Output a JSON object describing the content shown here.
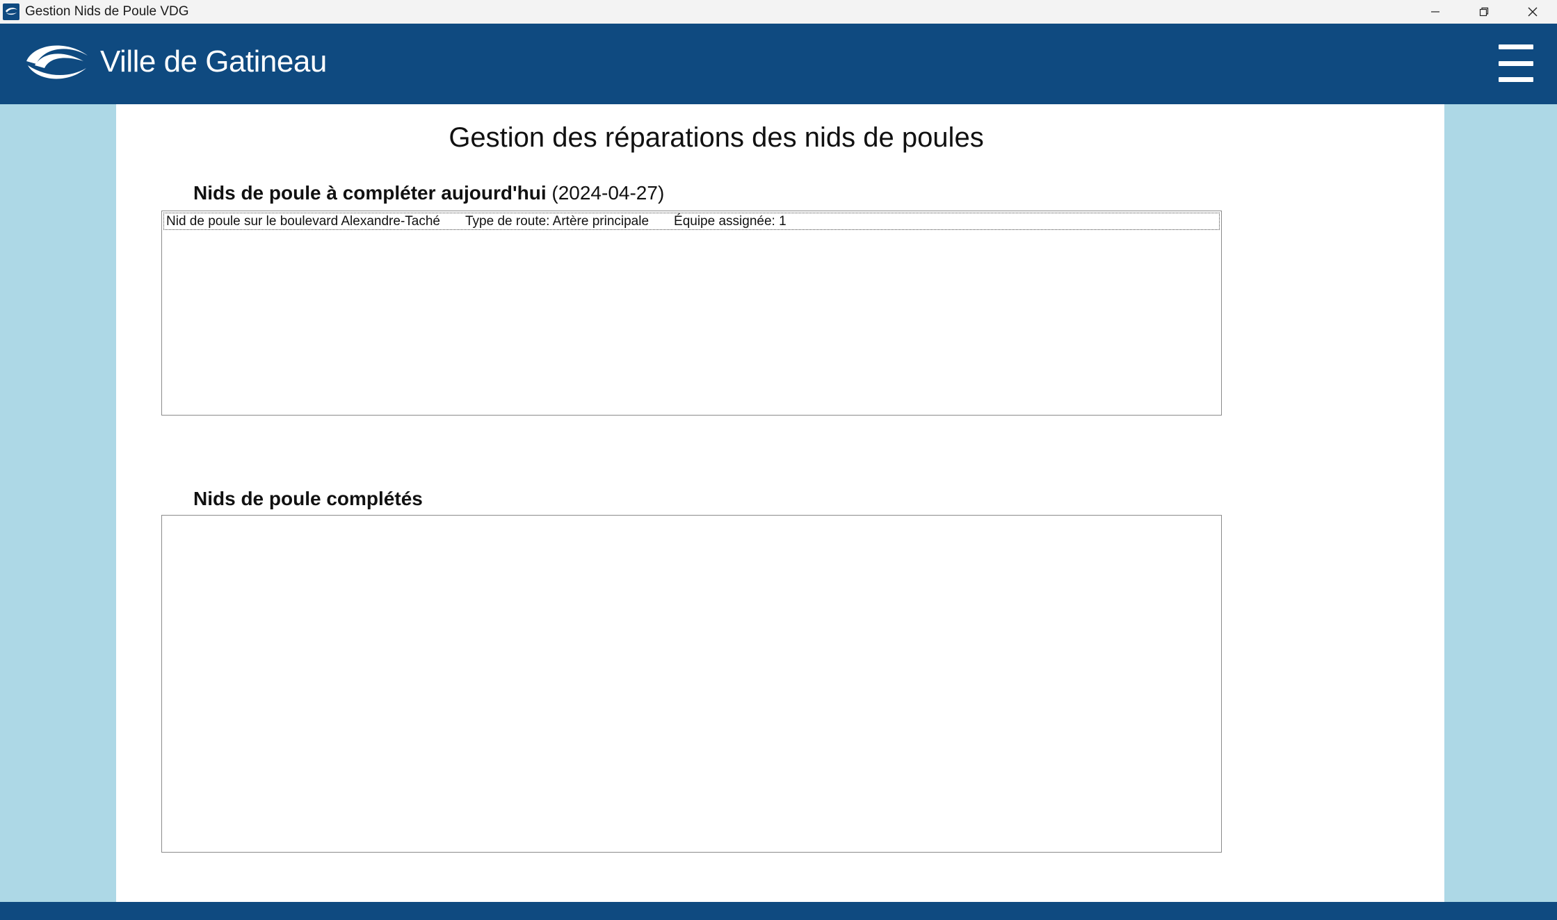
{
  "window": {
    "title": "Gestion Nids de Poule VDG"
  },
  "header": {
    "logo_text": "Ville de Gatineau",
    "menu_icon": "hamburger-menu-icon"
  },
  "main": {
    "title": "Gestion des réparations des nids de poules",
    "todo_section": {
      "label": "Nids de poule à compléter aujourd'hui",
      "date": "(2024-04-27)",
      "items": [
        {
          "name": "Nid de poule sur le boulevard Alexandre-Taché",
          "road_type": "Type de route: Artère principale",
          "team": "Équipe assignée: 1"
        }
      ]
    },
    "completed_section": {
      "label": "Nids de poule complétés",
      "items": []
    }
  },
  "colors": {
    "brand_blue": "#0f4a80",
    "side_background": "#add8e6"
  }
}
